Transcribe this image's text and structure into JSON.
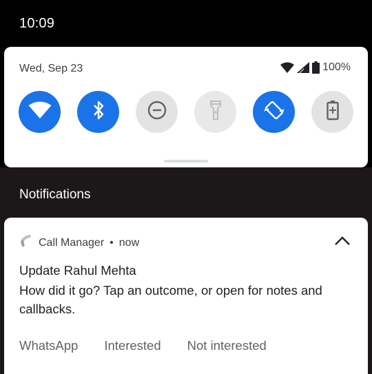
{
  "status_bar": {
    "time": "10:09"
  },
  "quick_settings": {
    "date": "Wed, Sep 23",
    "battery": "100%",
    "tiles": [
      {
        "name": "wifi",
        "icon": "wifi-icon",
        "state": "on"
      },
      {
        "name": "bluetooth",
        "icon": "bluetooth-icon",
        "state": "on"
      },
      {
        "name": "do-not-disturb",
        "icon": "do-not-disturb-icon",
        "state": "off"
      },
      {
        "name": "flashlight",
        "icon": "flashlight-icon",
        "state": "disabled"
      },
      {
        "name": "auto-rotate",
        "icon": "auto-rotate-icon",
        "state": "on"
      },
      {
        "name": "battery-saver",
        "icon": "battery-saver-icon",
        "state": "off"
      }
    ]
  },
  "notifications": {
    "header": "Notifications",
    "items": [
      {
        "app_name": "Call Manager",
        "separator": "•",
        "time": "now",
        "title": "Update Rahul Mehta",
        "body": "How did it go? Tap an outcome, or open for notes and callbacks.",
        "actions": [
          "WhatsApp",
          "Interested",
          "Not interested"
        ]
      }
    ]
  },
  "colors": {
    "accent": "#1a73e8",
    "tile_off": "#e3e3e3",
    "shade_background": "#1c1718"
  }
}
